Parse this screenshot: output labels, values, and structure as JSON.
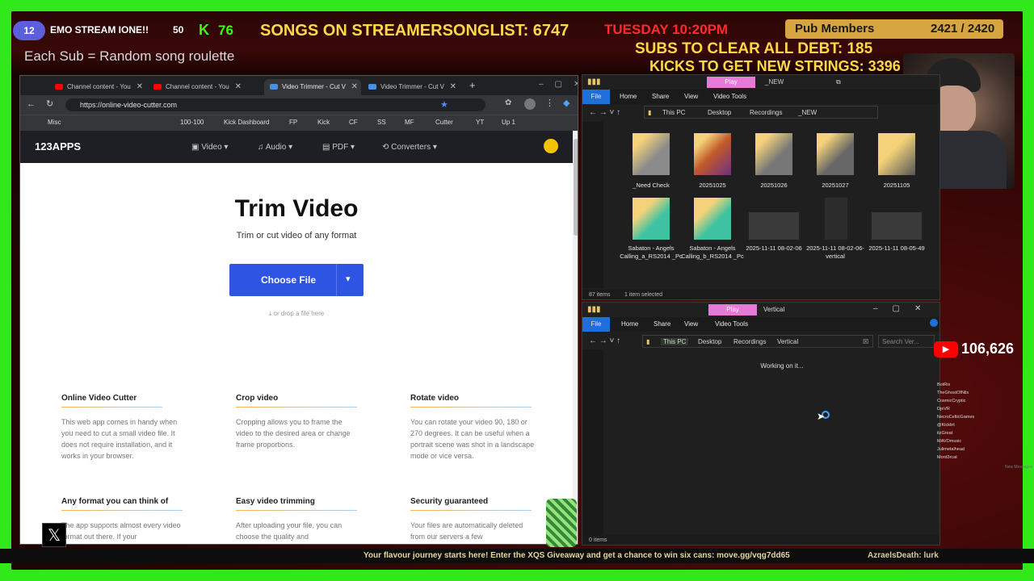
{
  "overlay": {
    "badge_left": "12",
    "stream_title": "EMO STREAM IONE!!",
    "stream_count": "50",
    "kick_count": "76",
    "songs_text": "SONGS ON STREAMERSONGLIST: 6747",
    "day_time": "TUESDAY 10:20PM",
    "pub_members_label": "Pub Members",
    "pub_members_value": "2421 / 2420",
    "each_sub": "Each Sub = Random song roulette",
    "subs_debt": "SUBS TO CLEAR ALL DEBT: 185",
    "kicks_strings": "KICKS TO GET NEW STRINGS: 3396",
    "youtube_count": "106,626",
    "ticker_text": "Your flavour journey starts here! Enter the XQS Giveaway and get a chance to win six cans: move.gg/vqg7dd65",
    "ticker_user": "AzraelsDeath: lurk",
    "leaderboard": [
      "BotRix",
      "TheGhostOfNils",
      "CosmicCryptic",
      "DjeVR",
      "NecroCelticGames",
      "@Kicklirt",
      "itzGreat",
      "MAVOmusic",
      "Julimetalhead",
      "Mord3rcat"
    ],
    "leaderboard_suffix": "New Messages"
  },
  "browser": {
    "tabs": [
      {
        "label": "Channel content - You"
      },
      {
        "label": "Channel content - You"
      },
      {
        "label": "Video Trimmer - Cut V"
      },
      {
        "label": "Video Trimmer - Cut V"
      }
    ],
    "url": "https://online-video-cutter.com",
    "bookmarks": [
      "Misc",
      "100-100",
      "Kick Dashboard",
      "FP",
      "Kick",
      "CF",
      "SS",
      "MF",
      "Cutter",
      "YT",
      "Up 1"
    ],
    "site": {
      "logo": "123APPS",
      "nav": [
        "Video",
        "Audio",
        "PDF",
        "Converters"
      ]
    },
    "page": {
      "title": "Trim Video",
      "subtitle": "Trim or cut video of any format",
      "choose_file": "Choose File",
      "drop_hint": "or drop a file here",
      "features": [
        {
          "title": "Online Video Cutter",
          "text": "This web app comes in handy when you need to cut a small video file. It does not require installation, and it works in your browser."
        },
        {
          "title": "Crop video",
          "text": "Cropping allows you to frame the video to the desired area or change frame proportions."
        },
        {
          "title": "Rotate video",
          "text": "You can rotate your video 90, 180 or 270 degrees. It can be useful when a portrait scene was shot in a landscape mode or vice versa."
        },
        {
          "title": "Any format you can think of",
          "text": "The app supports almost every video format out there. If your"
        },
        {
          "title": "Easy video trimming",
          "text": "After uploading your file, you can choose the quality and"
        },
        {
          "title": "Security guaranteed",
          "text": "Your files are automatically deleted from our servers a few"
        }
      ]
    }
  },
  "explorer_top": {
    "title": "_NEW",
    "play_tab": "Play",
    "ribbon": [
      "File",
      "Home",
      "Share",
      "View",
      "Video Tools"
    ],
    "path": [
      "This PC",
      "Desktop",
      "Recordings",
      "_NEW"
    ],
    "items": [
      "_Need Check",
      "20251025",
      "20251026",
      "20251027",
      "20251105",
      "Sabaton - Angels Calling_a_RS2014 _Pc",
      "Sabaton - Angels Calling_b_RS2014 _Pc",
      "2025-11-11 08-02-06",
      "2025-11-11 08-02-06-vertical",
      "2025-11-11 08-05-49"
    ],
    "status": "87 items",
    "selected": "1 item selected"
  },
  "explorer_bottom": {
    "title": "Vertical",
    "play_tab": "Play",
    "ribbon": [
      "File",
      "Home",
      "Share",
      "View",
      "Video Tools"
    ],
    "path": [
      "This PC",
      "Desktop",
      "Recordings",
      "Vertical"
    ],
    "search_placeholder": "Search Ver...",
    "working": "Working on it...",
    "status": "0 items"
  },
  "colors": {
    "accent_green": "#39ff14",
    "chrome_blue": "#2563eb",
    "explorer_bg": "#1f1f1f",
    "overlay_gold": "#ffd84a",
    "overlay_red": "#ff2b2b"
  }
}
